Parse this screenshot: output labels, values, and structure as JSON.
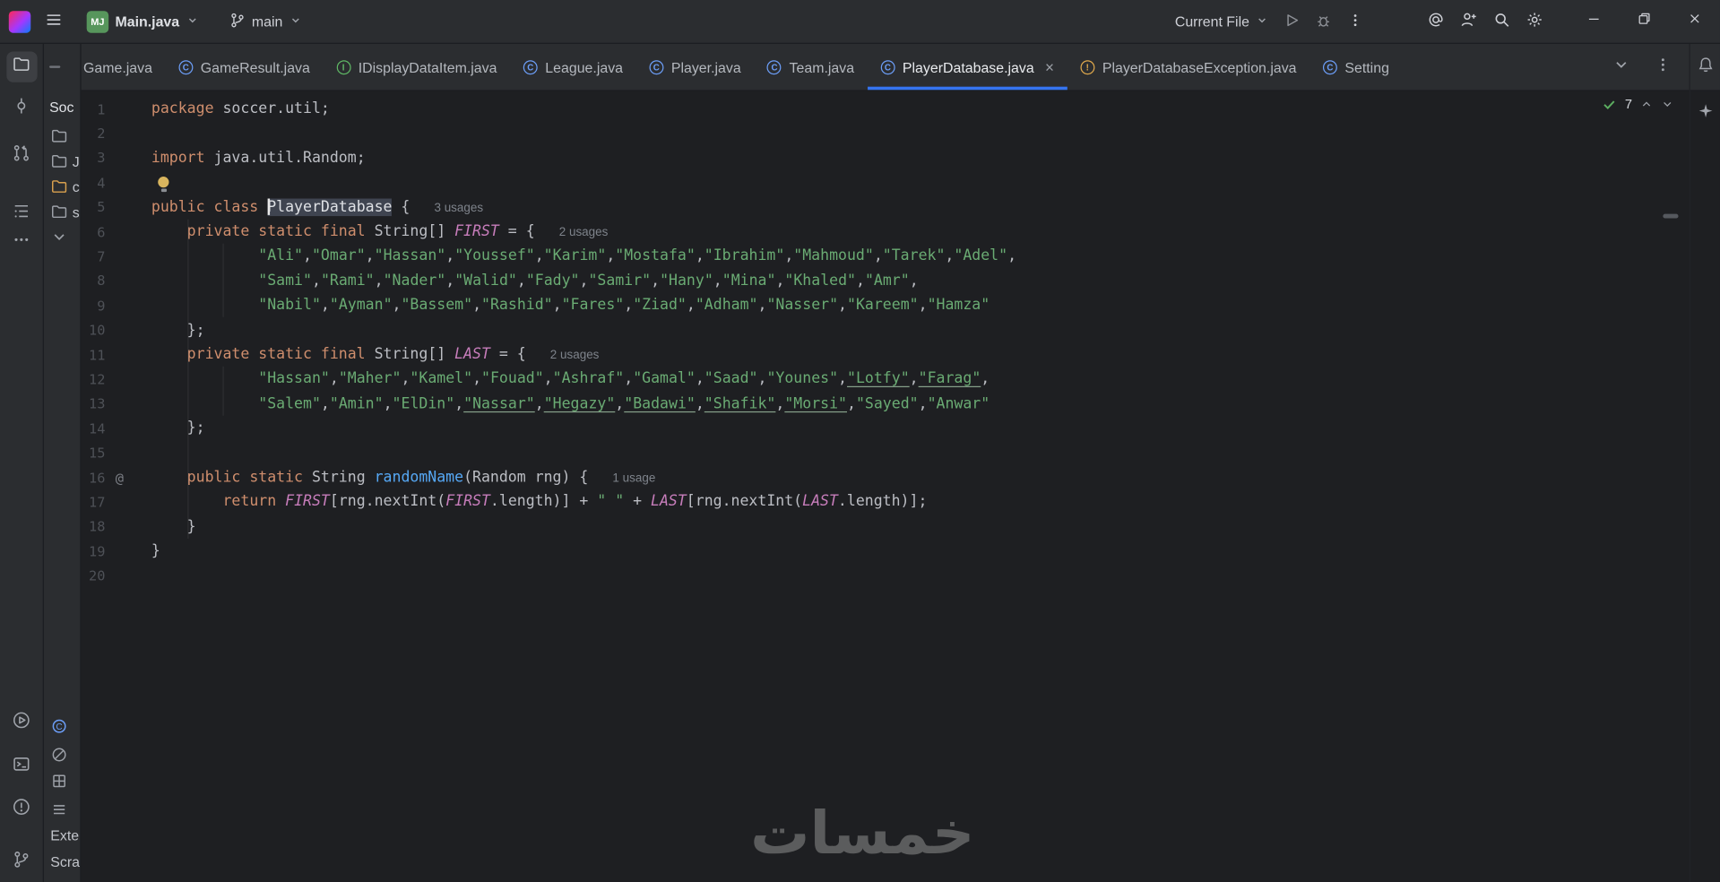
{
  "titlebar": {
    "project_abbrev": "MJ",
    "project_name": "Main.java",
    "branch_name": "main",
    "run_config": "Current File"
  },
  "tabbar": {
    "tabs": [
      {
        "label": "Game.java",
        "icon": "class",
        "clipped": true
      },
      {
        "label": "GameResult.java",
        "icon": "class"
      },
      {
        "label": "IDisplayDataItem.java",
        "icon": "interface"
      },
      {
        "label": "League.java",
        "icon": "class"
      },
      {
        "label": "Player.java",
        "icon": "class"
      },
      {
        "label": "Team.java",
        "icon": "class"
      },
      {
        "label": "PlayerDatabase.java",
        "icon": "class",
        "active": true
      },
      {
        "label": "PlayerDatabaseException.java",
        "icon": "exception"
      },
      {
        "label": "Setting",
        "icon": "class"
      }
    ]
  },
  "project_panel": {
    "root_label": "Soc",
    "tree_rows": [
      {
        "icon": "folder",
        "label": ""
      },
      {
        "icon": "folder",
        "label": "J"
      },
      {
        "icon": "folder-orange",
        "label": "c"
      },
      {
        "icon": "folder",
        "label": "s"
      },
      {
        "icon": "chevron-down",
        "label": ""
      }
    ],
    "bottom_rows": [
      {
        "icon": "class-file",
        "label": ""
      },
      {
        "icon": "blocked",
        "label": ""
      },
      {
        "icon": "module",
        "label": ""
      },
      {
        "icon": "list",
        "label": ""
      },
      {
        "icon": "",
        "label": "Exte"
      },
      {
        "icon": "",
        "label": "Scra"
      }
    ]
  },
  "editor": {
    "inspection_ok_count": "7",
    "lines": [
      {
        "n": 1,
        "t": [
          [
            "k",
            "package"
          ],
          [
            "d",
            " soccer.util;"
          ]
        ]
      },
      {
        "n": 2,
        "t": []
      },
      {
        "n": 3,
        "t": [
          [
            "k",
            "import"
          ],
          [
            "d",
            " java.util.Random;"
          ]
        ]
      },
      {
        "n": 4,
        "t": [
          [
            "bulb",
            ""
          ]
        ]
      },
      {
        "n": 5,
        "t": [
          [
            "k",
            "public class "
          ],
          [
            "caret",
            ""
          ],
          [
            "sel",
            "PlayerDatabase"
          ],
          [
            "d",
            " { "
          ]
        ],
        "hint": "3 usages"
      },
      {
        "n": 6,
        "t": [
          [
            "d",
            "    "
          ],
          [
            "k",
            "private static final "
          ],
          [
            "d",
            "String[] "
          ],
          [
            "c",
            "FIRST"
          ],
          [
            "d",
            " = { "
          ]
        ],
        "hint": "2 usages"
      },
      {
        "n": 7,
        "strings": {
          "words": [
            "Ali",
            "Omar",
            "Hassan",
            "Youssef",
            "Karim",
            "Mostafa",
            "Ibrahim",
            "Mahmoud",
            "Tarek",
            "Adel"
          ],
          "trailing": true,
          "underlined": []
        }
      },
      {
        "n": 8,
        "strings": {
          "words": [
            "Sami",
            "Rami",
            "Nader",
            "Walid",
            "Fady",
            "Samir",
            "Hany",
            "Mina",
            "Khaled",
            "Amr"
          ],
          "trailing": true,
          "underlined": []
        }
      },
      {
        "n": 9,
        "strings": {
          "words": [
            "Nabil",
            "Ayman",
            "Bassem",
            "Rashid",
            "Fares",
            "Ziad",
            "Adham",
            "Nasser",
            "Kareem",
            "Hamza"
          ],
          "trailing": false,
          "underlined": []
        }
      },
      {
        "n": 10,
        "t": [
          [
            "d",
            "    };"
          ]
        ]
      },
      {
        "n": 11,
        "t": [
          [
            "d",
            "    "
          ],
          [
            "k",
            "private static final "
          ],
          [
            "d",
            "String[] "
          ],
          [
            "c",
            "LAST"
          ],
          [
            "d",
            " = { "
          ]
        ],
        "hint": "2 usages"
      },
      {
        "n": 12,
        "strings": {
          "words": [
            "Hassan",
            "Maher",
            "Kamel",
            "Fouad",
            "Ashraf",
            "Gamal",
            "Saad",
            "Younes",
            "Lotfy",
            "Farag"
          ],
          "trailing": true,
          "underlined": [
            "Lotfy",
            "Farag"
          ]
        }
      },
      {
        "n": 13,
        "strings": {
          "words": [
            "Salem",
            "Amin",
            "ElDin",
            "Nassar",
            "Hegazy",
            "Badawi",
            "Shafik",
            "Morsi",
            "Sayed",
            "Anwar"
          ],
          "trailing": false,
          "underlined": [
            "Nassar",
            "Hegazy",
            "Badawi",
            "Shafik",
            "Morsi"
          ]
        }
      },
      {
        "n": 14,
        "t": [
          [
            "d",
            "    };"
          ]
        ]
      },
      {
        "n": 15,
        "t": []
      },
      {
        "n": 16,
        "gutter": "@",
        "t": [
          [
            "d",
            "    "
          ],
          [
            "k",
            "public static "
          ],
          [
            "d",
            "String "
          ],
          [
            "m",
            "randomName"
          ],
          [
            "d",
            "(Random rng) { "
          ]
        ],
        "hint": "1 usage"
      },
      {
        "n": 17,
        "t": [
          [
            "d",
            "        "
          ],
          [
            "k",
            "return "
          ],
          [
            "c",
            "FIRST"
          ],
          [
            "d",
            "[rng.nextInt("
          ],
          [
            "c",
            "FIRST"
          ],
          [
            "d",
            ".length)] + "
          ],
          [
            "s",
            "\" \""
          ],
          [
            "d",
            " + "
          ],
          [
            "c",
            "LAST"
          ],
          [
            "d",
            "[rng.nextInt("
          ],
          [
            "c",
            "LAST"
          ],
          [
            "d",
            ".length)];"
          ]
        ]
      },
      {
        "n": 18,
        "t": [
          [
            "d",
            "    }"
          ]
        ]
      },
      {
        "n": 19,
        "t": [
          [
            "d",
            "}"
          ]
        ]
      },
      {
        "n": 20,
        "t": []
      }
    ]
  },
  "watermark_text": "خمسات"
}
